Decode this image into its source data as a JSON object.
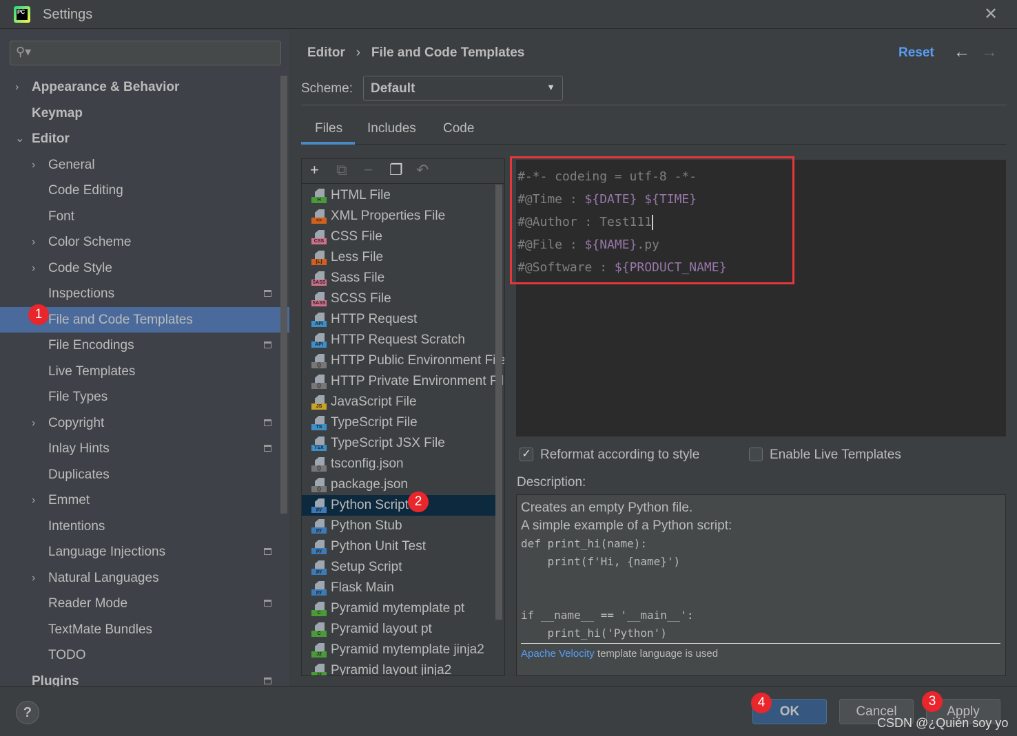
{
  "window": {
    "title": "Settings",
    "close_icon": "close-icon"
  },
  "search": {
    "placeholder": ""
  },
  "sidebar": {
    "items": [
      {
        "label": "Appearance & Behavior",
        "level": 0,
        "arrow": ">",
        "bold": true
      },
      {
        "label": "Keymap",
        "level": 0,
        "arrow": "",
        "bold": true
      },
      {
        "label": "Editor",
        "level": 0,
        "arrow": "v",
        "bold": true
      },
      {
        "label": "General",
        "level": 1,
        "arrow": ">"
      },
      {
        "label": "Code Editing",
        "level": 1,
        "arrow": ""
      },
      {
        "label": "Font",
        "level": 1,
        "arrow": ""
      },
      {
        "label": "Color Scheme",
        "level": 1,
        "arrow": ">"
      },
      {
        "label": "Code Style",
        "level": 1,
        "arrow": ">"
      },
      {
        "label": "Inspections",
        "level": 1,
        "arrow": "",
        "icon": true
      },
      {
        "label": "File and Code Templates",
        "level": 1,
        "arrow": "",
        "selected": true
      },
      {
        "label": "File Encodings",
        "level": 1,
        "arrow": "",
        "icon": true
      },
      {
        "label": "Live Templates",
        "level": 1,
        "arrow": ""
      },
      {
        "label": "File Types",
        "level": 1,
        "arrow": ""
      },
      {
        "label": "Copyright",
        "level": 1,
        "arrow": ">",
        "icon": true
      },
      {
        "label": "Inlay Hints",
        "level": 1,
        "arrow": "",
        "icon": true
      },
      {
        "label": "Duplicates",
        "level": 1,
        "arrow": ""
      },
      {
        "label": "Emmet",
        "level": 1,
        "arrow": ">"
      },
      {
        "label": "Intentions",
        "level": 1,
        "arrow": ""
      },
      {
        "label": "Language Injections",
        "level": 1,
        "arrow": "",
        "icon": true
      },
      {
        "label": "Natural Languages",
        "level": 1,
        "arrow": ">"
      },
      {
        "label": "Reader Mode",
        "level": 1,
        "arrow": "",
        "icon": true
      },
      {
        "label": "TextMate Bundles",
        "level": 1,
        "arrow": ""
      },
      {
        "label": "TODO",
        "level": 1,
        "arrow": ""
      },
      {
        "label": "Plugins",
        "level": 0,
        "arrow": "",
        "bold": true,
        "icon": true
      }
    ]
  },
  "breadcrumb": {
    "parent": "Editor",
    "separator": "›",
    "current": "File and Code Templates"
  },
  "header": {
    "reset": "Reset"
  },
  "scheme": {
    "label": "Scheme:",
    "value": "Default"
  },
  "tabs": [
    {
      "label": "Files",
      "active": true
    },
    {
      "label": "Includes"
    },
    {
      "label": "Code"
    }
  ],
  "toolbar": {
    "add": "+",
    "copy_disabled": "⧉",
    "remove": "−",
    "duplicate": "❐",
    "reset": "↶"
  },
  "templates": [
    {
      "label": "HTML File",
      "badge": "H",
      "color": "#4a9a3a"
    },
    {
      "label": "XML Properties File",
      "badge": "<>",
      "color": "#d0601f"
    },
    {
      "label": "CSS File",
      "badge": "CSS",
      "color": "#d0708a"
    },
    {
      "label": "Less File",
      "badge": "{L}",
      "color": "#d0601f"
    },
    {
      "label": "Sass File",
      "badge": "SASS",
      "color": "#d0708a"
    },
    {
      "label": "SCSS File",
      "badge": "SASS",
      "color": "#d0708a"
    },
    {
      "label": "HTTP Request",
      "badge": "API",
      "color": "#3d8fc8"
    },
    {
      "label": "HTTP Request Scratch",
      "badge": "API",
      "color": "#3d8fc8"
    },
    {
      "label": "HTTP Public Environment File",
      "badge": "{}",
      "color": "#777"
    },
    {
      "label": "HTTP Private Environment File",
      "badge": "{}",
      "color": "#777"
    },
    {
      "label": "JavaScript File",
      "badge": "JS",
      "color": "#c9a227"
    },
    {
      "label": "TypeScript File",
      "badge": "TS",
      "color": "#3d8fc8"
    },
    {
      "label": "TypeScript JSX File",
      "badge": "TSX",
      "color": "#3d8fc8"
    },
    {
      "label": "tsconfig.json",
      "badge": "{}",
      "color": "#777"
    },
    {
      "label": "package.json",
      "badge": "{}",
      "color": "#777"
    },
    {
      "label": "Python Script",
      "badge": "py",
      "color": "#3d7ab8",
      "selected": true
    },
    {
      "label": "Python Stub",
      "badge": "py",
      "color": "#3d7ab8"
    },
    {
      "label": "Python Unit Test",
      "badge": "py",
      "color": "#3d7ab8"
    },
    {
      "label": "Setup Script",
      "badge": "py",
      "color": "#3d7ab8"
    },
    {
      "label": "Flask Main",
      "badge": "py",
      "color": "#3d7ab8"
    },
    {
      "label": "Pyramid mytemplate pt",
      "badge": "C",
      "color": "#4a9a3a"
    },
    {
      "label": "Pyramid layout pt",
      "badge": "C",
      "color": "#4a9a3a"
    },
    {
      "label": "Pyramid mytemplate jinja2",
      "badge": "J2",
      "color": "#4a9a3a"
    },
    {
      "label": "Pyramid layout jinja2",
      "badge": "J2",
      "color": "#4a9a3a"
    }
  ],
  "editor": {
    "lines": [
      [
        {
          "t": "#-*- codeing = utf-8 -*-"
        }
      ],
      [
        {
          "t": "#@Time : "
        },
        {
          "t": "${DATE}",
          "v": 1
        },
        {
          "t": " "
        },
        {
          "t": "${TIME}",
          "v": 1
        }
      ],
      [
        {
          "t": "#@Author : Test111"
        }
      ],
      [
        {
          "t": "#@File : "
        },
        {
          "t": "${NAME}",
          "v": 1
        },
        {
          "t": ".py"
        }
      ],
      [
        {
          "t": "#@Software : "
        },
        {
          "t": "${PRODUCT_NAME}",
          "v": 1
        }
      ]
    ]
  },
  "options": {
    "reformat": {
      "label": "Reformat according to style",
      "checked": true
    },
    "live_templates": {
      "label": "Enable Live Templates",
      "checked": false
    }
  },
  "description": {
    "label": "Description:",
    "lines": [
      {
        "t": "Creates an empty Python file."
      },
      {
        "t": "A simple example of a Python script:"
      },
      {
        "t": "def print_hi(name):",
        "mono": true
      },
      {
        "t": "    print(f'Hi, {name}')",
        "mono": true
      },
      {
        "t": "",
        "mono": true
      },
      {
        "t": "",
        "mono": true
      },
      {
        "t": "if __name__ == '__main__':",
        "mono": true
      },
      {
        "t": "    print_hi('Python')",
        "mono": true
      }
    ],
    "footer_link": "Apache Velocity",
    "footer_text": " template language is used"
  },
  "buttons": {
    "help": "?",
    "ok": "OK",
    "cancel": "Cancel",
    "apply": "Apply"
  },
  "annotations": [
    "1",
    "2",
    "3",
    "4"
  ],
  "watermark": "CSDN @¿Quién soy yo",
  "colors": {
    "accent": "#589df6",
    "selection": "#4b6a9c",
    "list_selection": "#0d293e",
    "highlight_box": "#e8373a",
    "template_var": "#9876aa"
  }
}
